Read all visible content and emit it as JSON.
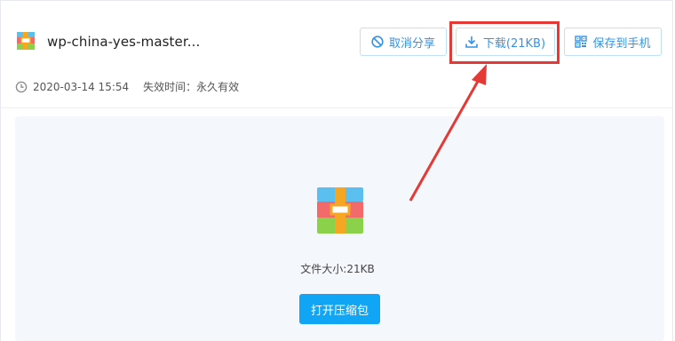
{
  "file": {
    "name": "wp-china-yes-master...",
    "date": "2020-03-14 15:54",
    "expire_label": "失效时间：",
    "expire_value": "永久有效",
    "size_text": "文件大小:21KB"
  },
  "toolbar": {
    "cancel_share": "取消分享",
    "download": "下载(21KB)",
    "save_to_phone": "保存到手机"
  },
  "preview": {
    "open_button": "打开压缩包"
  },
  "colors": {
    "accent": "#3294e8",
    "primary_button": "#11a6f5",
    "highlight": "#e53935"
  },
  "icons": {
    "file": "archive-icon",
    "cancel": "ban-icon",
    "download": "download-icon",
    "save": "qrcode-icon",
    "clock": "clock-icon"
  }
}
